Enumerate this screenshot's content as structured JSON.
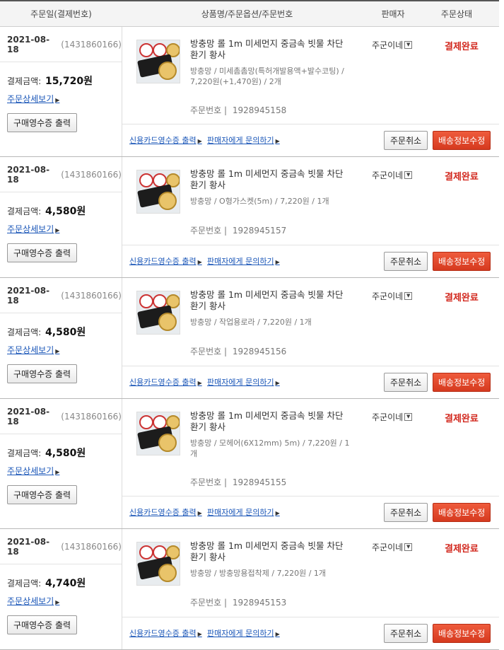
{
  "header": {
    "date_col": "주문일(결제번호)",
    "product_col": "상품명/주문옵션/주문번호",
    "seller_col": "판매자",
    "status_col": "주문상태"
  },
  "labels": {
    "pay_label": "결제금액:",
    "detail_link": "주문상세보기",
    "receipt_button": "구매영수증 출력",
    "order_no_label": "주문번호 |",
    "card_receipt": "신용카드영수증 출력",
    "ask_seller": "판매자에게 문의하기",
    "cancel_button": "주문취소",
    "ship_button": "배송정보수정"
  },
  "orders": [
    {
      "date": "2021-08-18",
      "pay_id": "(1431860166)",
      "amount": "15,720원",
      "name": "방충망 롤 1m 미세먼지 중금속 빗물 차단 환기 황사",
      "option": "방충망 / 미세촘촘망(특허개발용액+발수코팅) / 7,220원(+1,470원) / 2개",
      "order_no": "1928945158",
      "seller": "주군이네",
      "status": "결제완료"
    },
    {
      "date": "2021-08-18",
      "pay_id": "(1431860166)",
      "amount": "4,580원",
      "name": "방충망 롤 1m 미세먼지 중금속 빗물 차단 환기 황사",
      "option": "방충망 / O형가스켓(5m) / 7,220원 / 1개",
      "order_no": "1928945157",
      "seller": "주군이네",
      "status": "결제완료"
    },
    {
      "date": "2021-08-18",
      "pay_id": "(1431860166)",
      "amount": "4,580원",
      "name": "방충망 롤 1m 미세먼지 중금속 빗물 차단 환기 황사",
      "option": "방충망 / 작업용로라 / 7,220원 / 1개",
      "order_no": "1928945156",
      "seller": "주군이네",
      "status": "결제완료"
    },
    {
      "date": "2021-08-18",
      "pay_id": "(1431860166)",
      "amount": "4,580원",
      "name": "방충망 롤 1m 미세먼지 중금속 빗물 차단 환기 황사",
      "option": "방충망 / 모헤어(6X12mm) 5m) / 7,220원 / 1개",
      "order_no": "1928945155",
      "seller": "주군이네",
      "status": "결제완료"
    },
    {
      "date": "2021-08-18",
      "pay_id": "(1431860166)",
      "amount": "4,740원",
      "name": "방충망 롤 1m 미세먼지 중금속 빗물 차단 환기 황사",
      "option": "방충망 / 방충망용접착제 / 7,220원 / 1개",
      "order_no": "1928945153",
      "seller": "주군이네",
      "status": "결제완료"
    }
  ]
}
